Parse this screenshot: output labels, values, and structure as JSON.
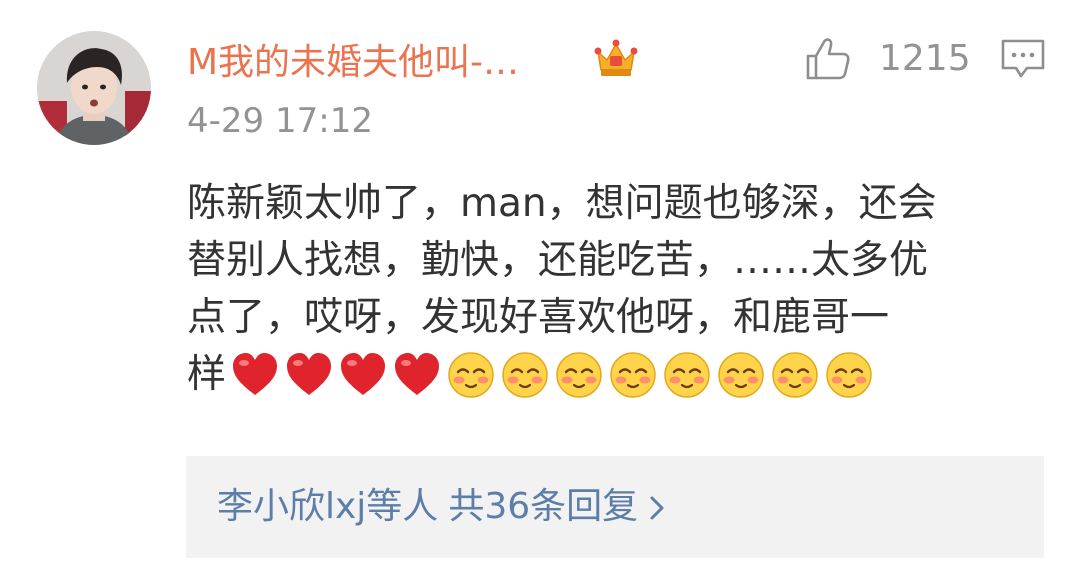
{
  "comment": {
    "username": "M我的未婚夫他叫-…",
    "timestamp": "4-29 17:12",
    "badge_icon": "crown-icon",
    "like_icon": "thumbs-up-icon",
    "like_count": "1215",
    "reply_icon": "comment-bubble-icon",
    "body_lines": [
      "陈新颖太帅了，man，想问题也够深，还会",
      "替别人找想，勤快，还能吃苦，……太多优",
      "点了，哎呀，发现好喜欢他呀，和鹿哥一"
    ],
    "last_line_text": "样",
    "emojis": [
      "heart",
      "heart",
      "heart",
      "heart",
      "blush",
      "blush",
      "blush",
      "blush",
      "blush",
      "blush",
      "blush",
      "blush"
    ],
    "replies": {
      "names": "李小欣lxj等人",
      "count_text": "共36条回复",
      "chevron_icon": "chevron-right-icon"
    }
  },
  "colors": {
    "username": "#eb7350",
    "secondary_text": "#939393",
    "body_text": "#333333",
    "reply_link": "#5d7ea8",
    "reply_bg": "#f2f2f2",
    "heart": "#e0242d",
    "crown": "#f5b02a"
  }
}
